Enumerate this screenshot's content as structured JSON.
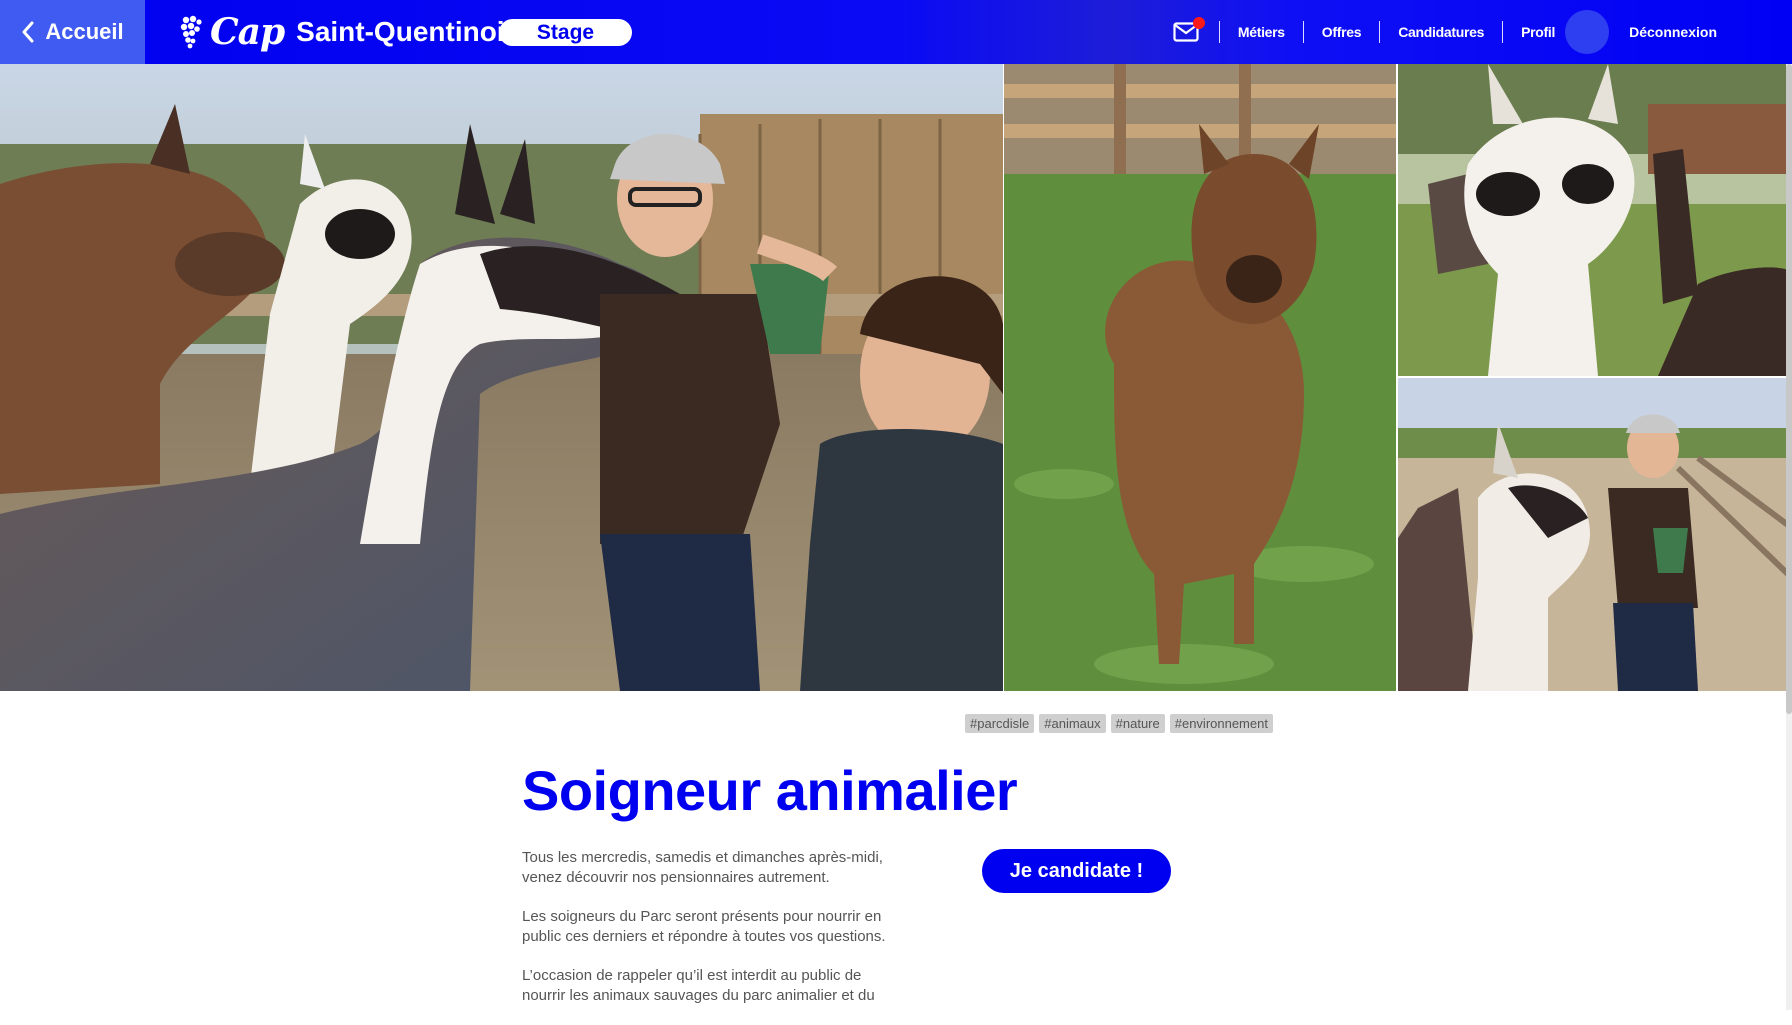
{
  "colors": {
    "primary": "#0000f0",
    "back_button": "#3f5bf2",
    "notification": "#ff1a1a",
    "tag_bg": "#cfcfcf"
  },
  "header": {
    "back_label": "Accueil",
    "brand_cap": "Cap",
    "brand_city": "Saint-Quentinois",
    "mode_label": "Stage",
    "has_unread_mail": true,
    "nav": [
      "Métiers",
      "Offres",
      "Candidatures",
      "Profil"
    ],
    "logout_label": "Déconnexion",
    "icons": {
      "back": "chevron-left-icon",
      "logo": "grapes-icon",
      "mail": "envelope-icon"
    }
  },
  "gallery": {
    "photos": [
      "llamas-with-keeper-photo",
      "alpaca-photo",
      "llama-closeup-photo",
      "keeper-feeding-llamas-photo"
    ]
  },
  "offer": {
    "tags": [
      "#parcdisle",
      "#animaux",
      "#nature",
      "#environnement"
    ],
    "title": "Soigneur animalier",
    "apply_label": "Je candidate !",
    "description": [
      "Tous les mercredis, samedis et dimanches après-midi, venez découvrir nos pensionnaires autrement.",
      "Les soigneurs du Parc seront présents pour nourrir en public ces derniers et répondre à toutes vos questions.",
      "L’occasion de rappeler qu’il est interdit au public de nourrir les animaux sauvages du parc animalier et du"
    ]
  }
}
